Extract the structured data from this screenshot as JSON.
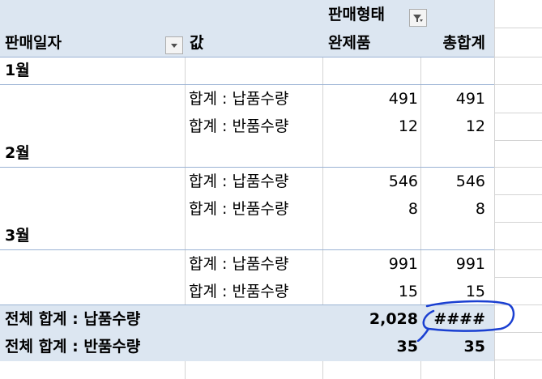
{
  "pivot": {
    "column_field_label": "판매형태",
    "row_field_label": "판매일자",
    "values_label": "값",
    "column_item": "완제품",
    "grand_total_column": "총합계",
    "groups": [
      {
        "month": "1월",
        "rows": [
          {
            "label": "합계 : 납품수량",
            "value": "491",
            "total": "491"
          },
          {
            "label": "합계 : 반품수량",
            "value": "12",
            "total": "12"
          }
        ]
      },
      {
        "month": "2월",
        "rows": [
          {
            "label": "합계 : 납품수량",
            "value": "546",
            "total": "546"
          },
          {
            "label": "합계 : 반품수량",
            "value": "8",
            "total": "8"
          }
        ]
      },
      {
        "month": "3월",
        "rows": [
          {
            "label": "합계 : 납품수량",
            "value": "991",
            "total": "991"
          },
          {
            "label": "합계 : 반품수량",
            "value": "15",
            "total": "15"
          }
        ]
      }
    ],
    "grand_totals": [
      {
        "label": "전체 합계 : 납품수량",
        "value": "2,028",
        "total": "####"
      },
      {
        "label": "전체 합계 : 반품수량",
        "value": "35",
        "total": "35"
      }
    ]
  },
  "colors": {
    "band": "#dce6f1",
    "annotation": "#1a3fd1"
  },
  "icons": {
    "filter": "filter-dropdown-icon",
    "dropdown": "dropdown-arrow-icon"
  }
}
